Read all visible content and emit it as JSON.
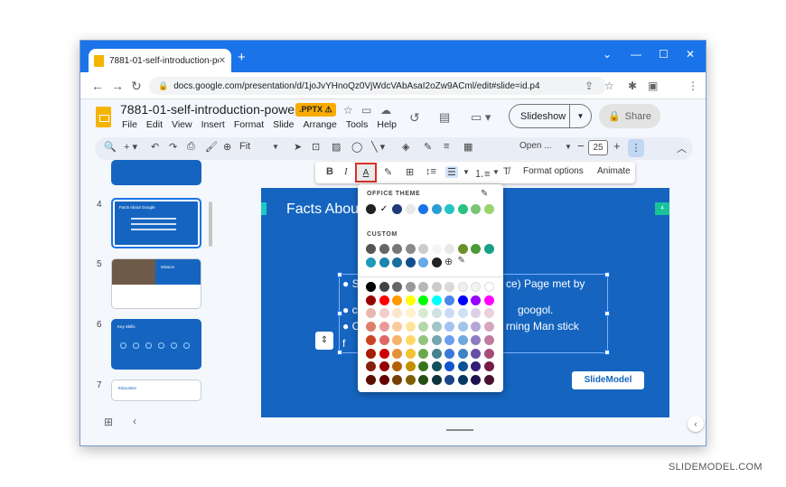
{
  "browser": {
    "tab_title": "7881-01-self-introduction-powe",
    "tab_close": "✕",
    "new_tab": "+",
    "url": "docs.google.com/presentation/d/1joJvYHnoQz0VjWdcVAbAsaI2oZw9ACml/edit#slide=id.p4"
  },
  "app": {
    "title": "7881-01-self-introduction-power...",
    "badge": ".PPTX",
    "menus": [
      "File",
      "Edit",
      "View",
      "Insert",
      "Format",
      "Slide",
      "Arrange",
      "Tools",
      "Help"
    ],
    "slideshow_label": "Slideshow",
    "share_label": "Share"
  },
  "toolbar": {
    "zoom": "Fit",
    "font": "Open ...",
    "font_size": "25",
    "format_options": "Format options",
    "animate": "Animate"
  },
  "filmstrip": {
    "slides": [
      {
        "num": "4",
        "title": "Facts About Google",
        "selected": true
      },
      {
        "num": "5",
        "title": "Mission"
      },
      {
        "num": "6",
        "title": "Key Skills"
      },
      {
        "num": "7",
        "title": "Education"
      }
    ]
  },
  "slide": {
    "title": "Facts Abou",
    "number_badge": "4",
    "bullets": [
      "S",
      "c",
      "C",
      "f"
    ],
    "bullet_tails": [
      "ce) Page met by",
      "googol.",
      "rning Man stick",
      ""
    ],
    "logo": "SlideModel"
  },
  "color_picker": {
    "theme_label": "OFFICE THEME",
    "custom_label": "CUSTOM",
    "theme_colors": [
      "#222222",
      "#ffffff",
      "#1f3b78",
      "#e8e8e8",
      "#1a73e8",
      "#2a9fd6",
      "#25c4c4",
      "#26c281",
      "#7cc576",
      "#9bd46e"
    ],
    "custom_colors_row1": [
      "#555555",
      "#666666",
      "#777777",
      "#8a8a8a",
      "#cccccc",
      "#f5f5f5",
      "#e8e8e8",
      "#6c8f2b",
      "#4a9a36",
      "#17a085"
    ],
    "custom_colors_row2": [
      "#1e9ab8",
      "#1a85b0",
      "#176ea0",
      "#134e8c",
      "#66a8e8",
      "#222222"
    ],
    "grid": [
      [
        "#000000",
        "#434343",
        "#666666",
        "#999999",
        "#b7b7b7",
        "#cccccc",
        "#d9d9d9",
        "#efefef",
        "#f3f3f3",
        "#ffffff"
      ],
      [
        "#980000",
        "#ff0000",
        "#ff9900",
        "#ffff00",
        "#00ff00",
        "#00ffff",
        "#4a86e8",
        "#0000ff",
        "#9900ff",
        "#ff00ff"
      ],
      [
        "#e6b8af",
        "#f4cccc",
        "#fce5cd",
        "#fff2cc",
        "#d9ead3",
        "#d0e0e3",
        "#c9daf8",
        "#cfe2f3",
        "#d9d2e9",
        "#ead1dc"
      ],
      [
        "#dd7e6b",
        "#ea9999",
        "#f9cb9c",
        "#ffe599",
        "#b6d7a8",
        "#a2c4c9",
        "#a4c2f4",
        "#9fc5e8",
        "#b4a7d6",
        "#d5a6bd"
      ],
      [
        "#cc4125",
        "#e06666",
        "#f6b26b",
        "#ffd966",
        "#93c47d",
        "#76a5af",
        "#6d9eeb",
        "#6fa8dc",
        "#8e7cc3",
        "#c27ba0"
      ],
      [
        "#a61c00",
        "#cc0000",
        "#e69138",
        "#f1c232",
        "#6aa84f",
        "#45818e",
        "#3c78d8",
        "#3d85c6",
        "#674ea7",
        "#a64d79"
      ],
      [
        "#85200c",
        "#990000",
        "#b45f06",
        "#bf9000",
        "#38761d",
        "#134f5c",
        "#1155cc",
        "#0b5394",
        "#351c75",
        "#741b47"
      ],
      [
        "#5b0f00",
        "#660000",
        "#783f04",
        "#7f6000",
        "#274e13",
        "#0c343d",
        "#1c4587",
        "#073763",
        "#20124d",
        "#4c1130"
      ]
    ]
  },
  "watermark": "SLIDEMODEL.COM"
}
